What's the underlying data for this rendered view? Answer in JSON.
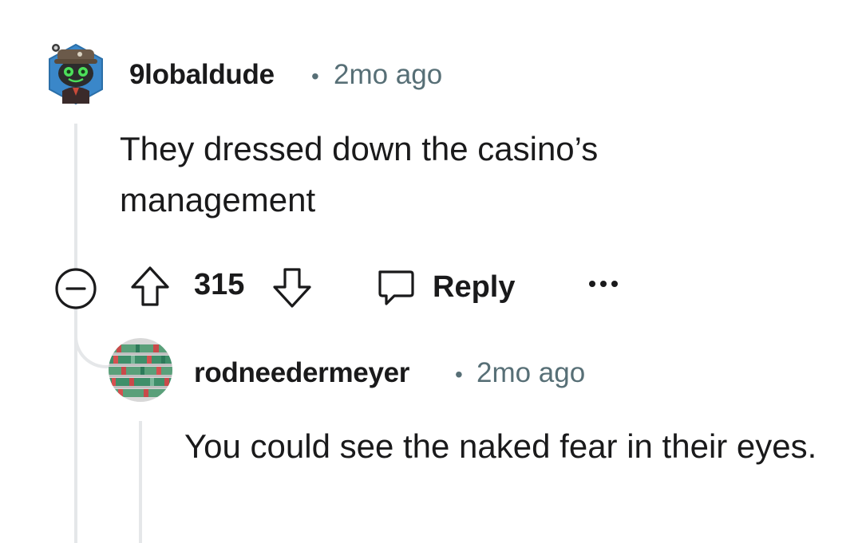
{
  "comment": {
    "username": "9lobaldude",
    "separator": "•",
    "timestamp": "2mo ago",
    "body": "They dressed down the casino’s management",
    "score": "315",
    "actions": {
      "reply_label": "Reply",
      "collapse_icon": "minus-circle-icon",
      "upvote_icon": "arrow-up-outline-icon",
      "downvote_icon": "arrow-down-outline-icon",
      "reply_icon": "speech-bubble-icon",
      "more_icon": "ellipsis-icon"
    }
  },
  "reply": {
    "username": "rodneedermeyer",
    "separator": "•",
    "timestamp": "2mo ago",
    "body": "You could see the naked fear in their eyes."
  },
  "colors": {
    "text": "#1a1a1b",
    "meta": "#576f76",
    "thread_line": "#e5e7e9"
  }
}
